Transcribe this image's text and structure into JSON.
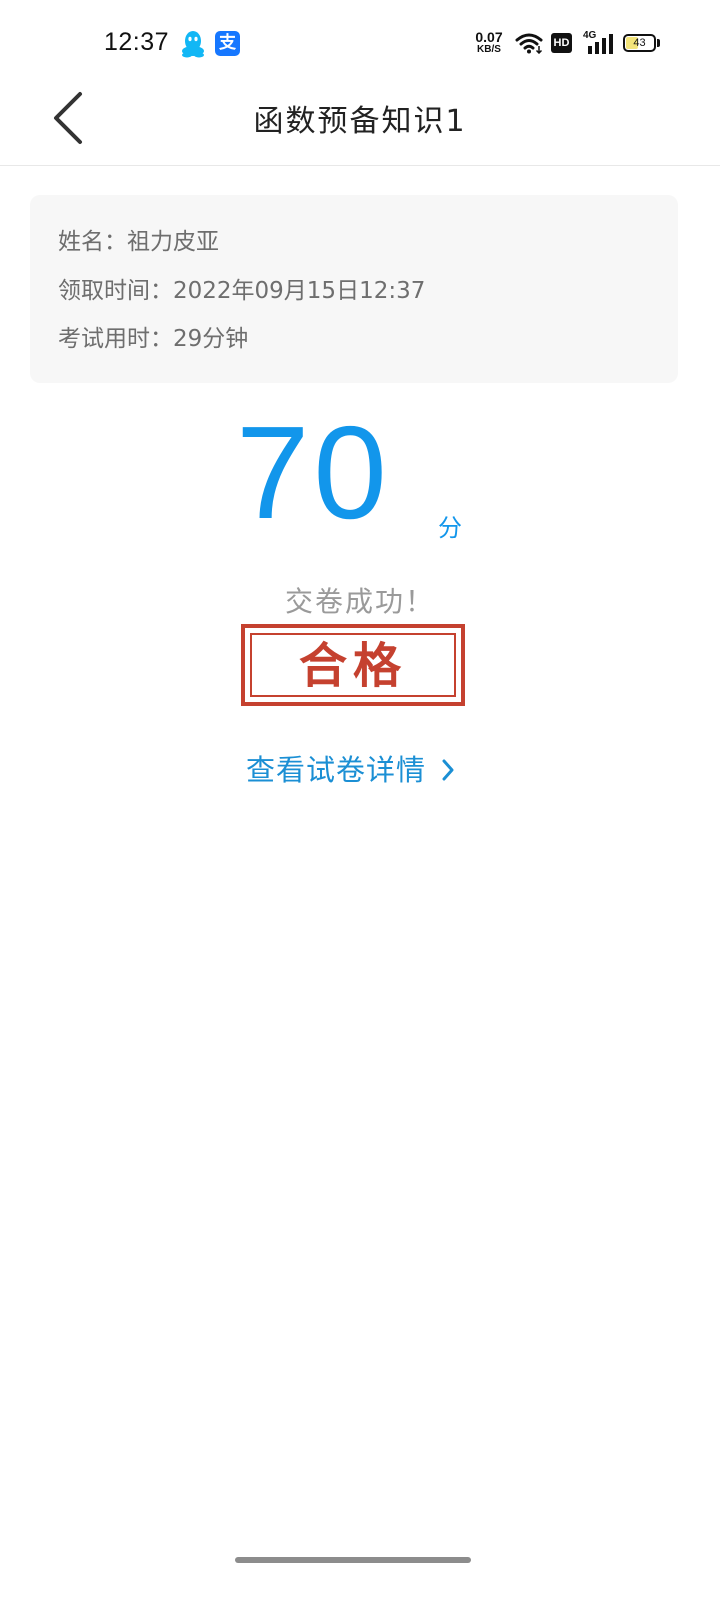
{
  "status_bar": {
    "time": "12:37",
    "net_speed": "0.07",
    "net_speed_unit": "KB/S",
    "hd_label": "HD",
    "signal_label": "4G",
    "battery_level": "43",
    "battery_fraction": 0.43,
    "alipay_glyph": "支",
    "icons": [
      "qq-icon",
      "alipay-icon",
      "wifi-icon",
      "signal-icon",
      "battery-icon"
    ]
  },
  "header": {
    "title": "函数预备知识1",
    "back_icon": "chevron-left-icon"
  },
  "info": {
    "name": "姓名：祖力皮亚",
    "receive_time": "领取时间：2022年09月15日12:37",
    "exam_duration": "考试用时：29分钟"
  },
  "score": {
    "value": "70",
    "unit": "分"
  },
  "result": {
    "message": "交卷成功！",
    "stamp": "合格"
  },
  "actions": {
    "view_details": "查看试卷详情",
    "view_details_icon": "chevron-right-icon"
  },
  "colors": {
    "accent": "#1296eb",
    "link": "#1b8fd4",
    "stamp": "#c5412f",
    "muted_text": "#6e6e6e",
    "card_bg": "#f7f7f7"
  }
}
